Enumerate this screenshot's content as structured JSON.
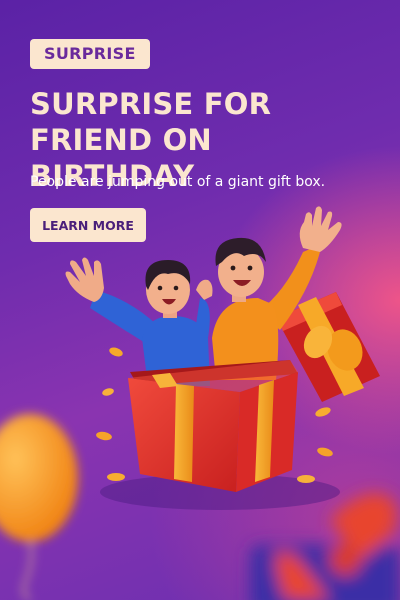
{
  "badge": {
    "label": "SURPRISE"
  },
  "headline": {
    "line1": "SURPRISE FOR",
    "line2": "FRIEND ON BIRTHDAY"
  },
  "subtitle": "People are jumping out of a giant gift box.",
  "cta": {
    "label": "LEARN MORE"
  },
  "colors": {
    "accent": "#fbe6cf",
    "gift_box": "#e8312f",
    "ribbon": "#f7a928",
    "balloon": "#f59a25"
  }
}
